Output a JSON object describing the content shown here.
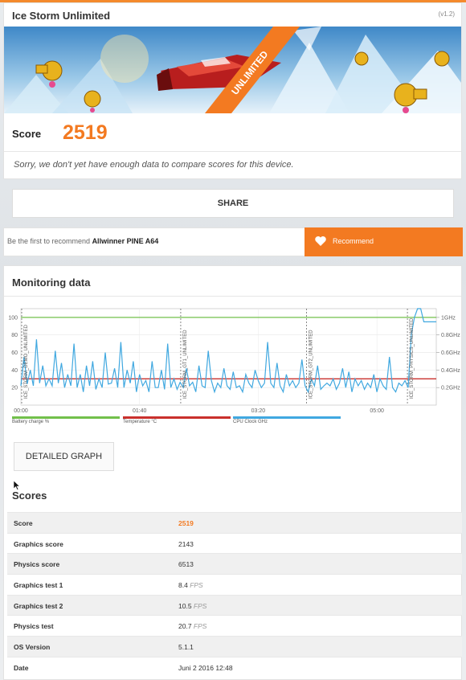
{
  "header": {
    "title": "Ice Storm Unlimited",
    "version": "(v1.2)",
    "banner_ribbon": "UNLIMITED",
    "score_label": "Score",
    "score_value": "2519",
    "sorry_text": "Sorry, we don't yet have enough data to compare scores for this device."
  },
  "share": {
    "label": "SHARE"
  },
  "recommend": {
    "prefix": "Be the first to recommend",
    "device": "Allwinner PINE A64",
    "button_label": "Recommend"
  },
  "monitoring": {
    "title": "Monitoring data",
    "detail_button": "DETAILED GRAPH",
    "legend": [
      {
        "label": "Battery charge %",
        "color": "#72c04b"
      },
      {
        "label": "Temperature °C",
        "color": "#c9302c"
      },
      {
        "label": "CPU Clock GHz",
        "color": "#40a8e0"
      }
    ]
  },
  "chart_data": {
    "type": "line",
    "x_ticks": [
      "00:00",
      "01:40",
      "03:20",
      "05:00"
    ],
    "y_left_ticks": [
      "100",
      "80",
      "60",
      "40",
      "20"
    ],
    "y_right_ticks": [
      "1GHz",
      "0.8GHz",
      "0.6GHz",
      "0.4GHz",
      "0.2GHz"
    ],
    "ylim": [
      0,
      110
    ],
    "grid": true,
    "phases": [
      "ICE_STORM_DEMO_UNLIMITED",
      "ICE_STORM_GT1_UNLIMITED",
      "ICE_STORM_GT2_UNLIMITED",
      "ICE_STORM_PHYSICS_UNLIMITED"
    ],
    "series": [
      {
        "name": "Battery charge %",
        "color": "#72c04b",
        "values": [
          100,
          100
        ]
      },
      {
        "name": "Temperature °C",
        "color": "#c9302c",
        "values": [
          30,
          30
        ]
      },
      {
        "name": "CPU Clock GHz",
        "color": "#40a8e0",
        "values": [
          22,
          55,
          24,
          40,
          22,
          75,
          25,
          45,
          22,
          30,
          22,
          62,
          25,
          48,
          20,
          35,
          22,
          70,
          20,
          35,
          15,
          45,
          22,
          50,
          18,
          30,
          20,
          60,
          24,
          25,
          42,
          20,
          72,
          20,
          40,
          25,
          50,
          15,
          35,
          22,
          28,
          15,
          50,
          20,
          20,
          40,
          18,
          70,
          20,
          30,
          18,
          26,
          20,
          42,
          22,
          26,
          15,
          45,
          22,
          20,
          62,
          28,
          15,
          25,
          20,
          42,
          22,
          18,
          38,
          20,
          22,
          15,
          35,
          25,
          20,
          40,
          28,
          20,
          25,
          72,
          25,
          20,
          48,
          22,
          15,
          35,
          22,
          28,
          20,
          25,
          52,
          22,
          15,
          30,
          22,
          45,
          18,
          22,
          25,
          22,
          30,
          18,
          25,
          42,
          20,
          38,
          15,
          30,
          22,
          28,
          18,
          25,
          20,
          35,
          15,
          30,
          22,
          18,
          55,
          20,
          15,
          25,
          22,
          28,
          20,
          80,
          100,
          110,
          110,
          95,
          95,
          95,
          95,
          95
        ]
      }
    ]
  },
  "scores": {
    "title": "Scores",
    "rows": [
      {
        "key": "Score",
        "value": "2519",
        "unit": ""
      },
      {
        "key": "Graphics score",
        "value": "2143",
        "unit": ""
      },
      {
        "key": "Physics score",
        "value": "6513",
        "unit": ""
      },
      {
        "key": "Graphics test 1",
        "value": "8.4",
        "unit": "FPS"
      },
      {
        "key": "Graphics test 2",
        "value": "10.5",
        "unit": "FPS"
      },
      {
        "key": "Physics test",
        "value": "20.7",
        "unit": "FPS"
      },
      {
        "key": "OS Version",
        "value": "5.1.1",
        "unit": ""
      },
      {
        "key": "Date",
        "value": "Juni 2 2016 12:48",
        "unit": ""
      }
    ]
  }
}
